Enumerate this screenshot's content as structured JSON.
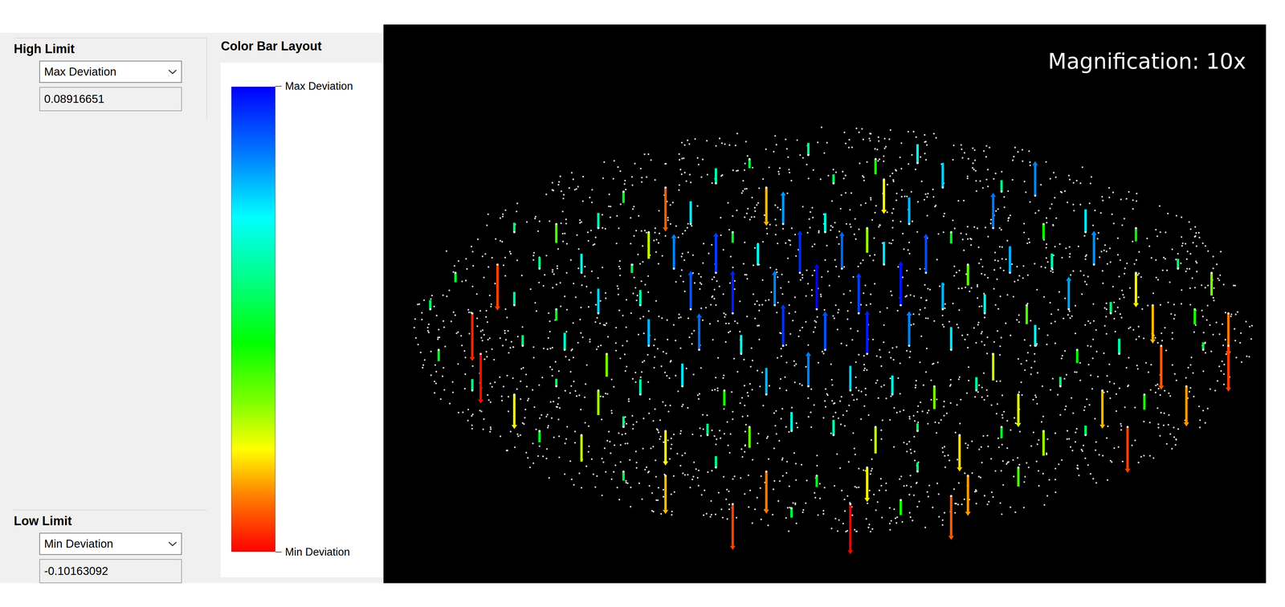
{
  "high_limit": {
    "title": "High Limit",
    "mode": "Max Deviation",
    "value": "0.08916651"
  },
  "color_bar": {
    "title": "Color Bar Layout",
    "top_label": "Max Deviation",
    "bottom_label": "Min Deviation"
  },
  "low_limit": {
    "title": "Low Limit",
    "mode": "Min Deviation",
    "value": "-0.10163092"
  },
  "plot": {
    "magnification": "Magnification: 10x",
    "min": -0.10163092,
    "max": 0.08916651,
    "points": [
      [
        0.4,
        0.08,
        -0.004
      ],
      [
        0.47,
        0.07,
        0.012
      ],
      [
        0.55,
        0.08,
        -0.02
      ],
      [
        0.6,
        0.09,
        0.03
      ],
      [
        0.25,
        0.16,
        -0.01
      ],
      [
        0.3,
        0.15,
        -0.085
      ],
      [
        0.36,
        0.14,
        0.02
      ],
      [
        0.42,
        0.15,
        -0.07
      ],
      [
        0.5,
        0.14,
        0.004
      ],
      [
        0.56,
        0.13,
        -0.06
      ],
      [
        0.63,
        0.15,
        0.045
      ],
      [
        0.7,
        0.16,
        0.01
      ],
      [
        0.74,
        0.17,
        0.06
      ],
      [
        0.12,
        0.26,
        0.005
      ],
      [
        0.17,
        0.24,
        -0.03
      ],
      [
        0.22,
        0.25,
        0.02
      ],
      [
        0.28,
        0.26,
        -0.05
      ],
      [
        0.33,
        0.24,
        0.04
      ],
      [
        0.38,
        0.26,
        -0.008
      ],
      [
        0.44,
        0.24,
        0.055
      ],
      [
        0.49,
        0.26,
        0.03
      ],
      [
        0.54,
        0.25,
        -0.045
      ],
      [
        0.59,
        0.24,
        0.05
      ],
      [
        0.64,
        0.26,
        -0.01
      ],
      [
        0.69,
        0.25,
        0.062
      ],
      [
        0.75,
        0.24,
        -0.02
      ],
      [
        0.8,
        0.26,
        0.04
      ],
      [
        0.86,
        0.25,
        -0.015
      ],
      [
        0.05,
        0.36,
        -0.005
      ],
      [
        0.1,
        0.34,
        -0.09
      ],
      [
        0.15,
        0.35,
        0.01
      ],
      [
        0.2,
        0.36,
        0.03
      ],
      [
        0.26,
        0.34,
        -0.002
      ],
      [
        0.31,
        0.35,
        0.06
      ],
      [
        0.36,
        0.36,
        0.075
      ],
      [
        0.41,
        0.34,
        0.035
      ],
      [
        0.46,
        0.36,
        0.08
      ],
      [
        0.51,
        0.35,
        0.066
      ],
      [
        0.56,
        0.34,
        0.04
      ],
      [
        0.61,
        0.36,
        0.072
      ],
      [
        0.66,
        0.34,
        -0.035
      ],
      [
        0.71,
        0.36,
        0.05
      ],
      [
        0.76,
        0.35,
        0.02
      ],
      [
        0.81,
        0.34,
        0.058
      ],
      [
        0.86,
        0.36,
        -0.06
      ],
      [
        0.91,
        0.35,
        0.006
      ],
      [
        0.95,
        0.36,
        -0.04
      ],
      [
        0.02,
        0.45,
        0.004
      ],
      [
        0.07,
        0.46,
        -0.095
      ],
      [
        0.12,
        0.44,
        0.015
      ],
      [
        0.17,
        0.45,
        -0.01
      ],
      [
        0.22,
        0.46,
        0.045
      ],
      [
        0.27,
        0.44,
        0.02
      ],
      [
        0.33,
        0.45,
        0.07
      ],
      [
        0.38,
        0.46,
        0.082
      ],
      [
        0.43,
        0.44,
        0.06
      ],
      [
        0.48,
        0.45,
        0.089
      ],
      [
        0.53,
        0.46,
        0.075
      ],
      [
        0.58,
        0.44,
        0.085
      ],
      [
        0.63,
        0.45,
        0.05
      ],
      [
        0.68,
        0.46,
        0.03
      ],
      [
        0.73,
        0.44,
        -0.03
      ],
      [
        0.78,
        0.45,
        0.055
      ],
      [
        0.83,
        0.46,
        0.01
      ],
      [
        0.88,
        0.44,
        -0.07
      ],
      [
        0.93,
        0.45,
        -0.02
      ],
      [
        0.97,
        0.46,
        -0.08
      ],
      [
        0.03,
        0.55,
        -0.01
      ],
      [
        0.08,
        0.56,
        -0.1
      ],
      [
        0.13,
        0.54,
        0.008
      ],
      [
        0.18,
        0.55,
        0.025
      ],
      [
        0.23,
        0.56,
        -0.04
      ],
      [
        0.28,
        0.54,
        0.05
      ],
      [
        0.34,
        0.55,
        0.065
      ],
      [
        0.39,
        0.56,
        0.03
      ],
      [
        0.44,
        0.54,
        0.078
      ],
      [
        0.49,
        0.55,
        0.07
      ],
      [
        0.54,
        0.56,
        0.083
      ],
      [
        0.59,
        0.54,
        0.06
      ],
      [
        0.64,
        0.55,
        0.04
      ],
      [
        0.69,
        0.56,
        -0.05
      ],
      [
        0.74,
        0.54,
        0.035
      ],
      [
        0.79,
        0.55,
        -0.015
      ],
      [
        0.84,
        0.56,
        0.02
      ],
      [
        0.89,
        0.54,
        -0.085
      ],
      [
        0.94,
        0.55,
        0.0
      ],
      [
        0.97,
        0.54,
        -0.09
      ],
      [
        0.07,
        0.65,
        0.01
      ],
      [
        0.12,
        0.66,
        -0.06
      ],
      [
        0.17,
        0.64,
        0.0
      ],
      [
        0.22,
        0.65,
        -0.045
      ],
      [
        0.27,
        0.66,
        0.02
      ],
      [
        0.32,
        0.64,
        0.04
      ],
      [
        0.37,
        0.65,
        -0.02
      ],
      [
        0.42,
        0.66,
        0.05
      ],
      [
        0.47,
        0.64,
        0.06
      ],
      [
        0.52,
        0.65,
        0.045
      ],
      [
        0.57,
        0.66,
        0.03
      ],
      [
        0.62,
        0.64,
        -0.04
      ],
      [
        0.67,
        0.65,
        0.015
      ],
      [
        0.72,
        0.66,
        -0.055
      ],
      [
        0.77,
        0.64,
        0.005
      ],
      [
        0.82,
        0.65,
        -0.07
      ],
      [
        0.87,
        0.66,
        -0.02
      ],
      [
        0.92,
        0.64,
        -0.075
      ],
      [
        0.15,
        0.75,
        -0.01
      ],
      [
        0.2,
        0.76,
        -0.05
      ],
      [
        0.25,
        0.74,
        0.008
      ],
      [
        0.3,
        0.75,
        -0.06
      ],
      [
        0.35,
        0.76,
        0.01
      ],
      [
        0.4,
        0.74,
        -0.035
      ],
      [
        0.45,
        0.75,
        0.03
      ],
      [
        0.5,
        0.76,
        0.02
      ],
      [
        0.55,
        0.74,
        -0.05
      ],
      [
        0.6,
        0.75,
        0.0
      ],
      [
        0.65,
        0.76,
        -0.065
      ],
      [
        0.7,
        0.74,
        -0.01
      ],
      [
        0.75,
        0.75,
        -0.045
      ],
      [
        0.8,
        0.76,
        0.005
      ],
      [
        0.85,
        0.74,
        -0.09
      ],
      [
        0.25,
        0.85,
        -0.004
      ],
      [
        0.3,
        0.86,
        -0.07
      ],
      [
        0.36,
        0.84,
        0.01
      ],
      [
        0.42,
        0.85,
        -0.08
      ],
      [
        0.48,
        0.86,
        -0.01
      ],
      [
        0.54,
        0.84,
        -0.06
      ],
      [
        0.6,
        0.85,
        0.004
      ],
      [
        0.66,
        0.86,
        -0.075
      ],
      [
        0.72,
        0.84,
        -0.03
      ],
      [
        0.38,
        0.93,
        -0.09
      ],
      [
        0.45,
        0.94,
        -0.005
      ],
      [
        0.52,
        0.93,
        -0.1016
      ],
      [
        0.58,
        0.92,
        -0.02
      ],
      [
        0.64,
        0.91,
        -0.085
      ]
    ]
  }
}
